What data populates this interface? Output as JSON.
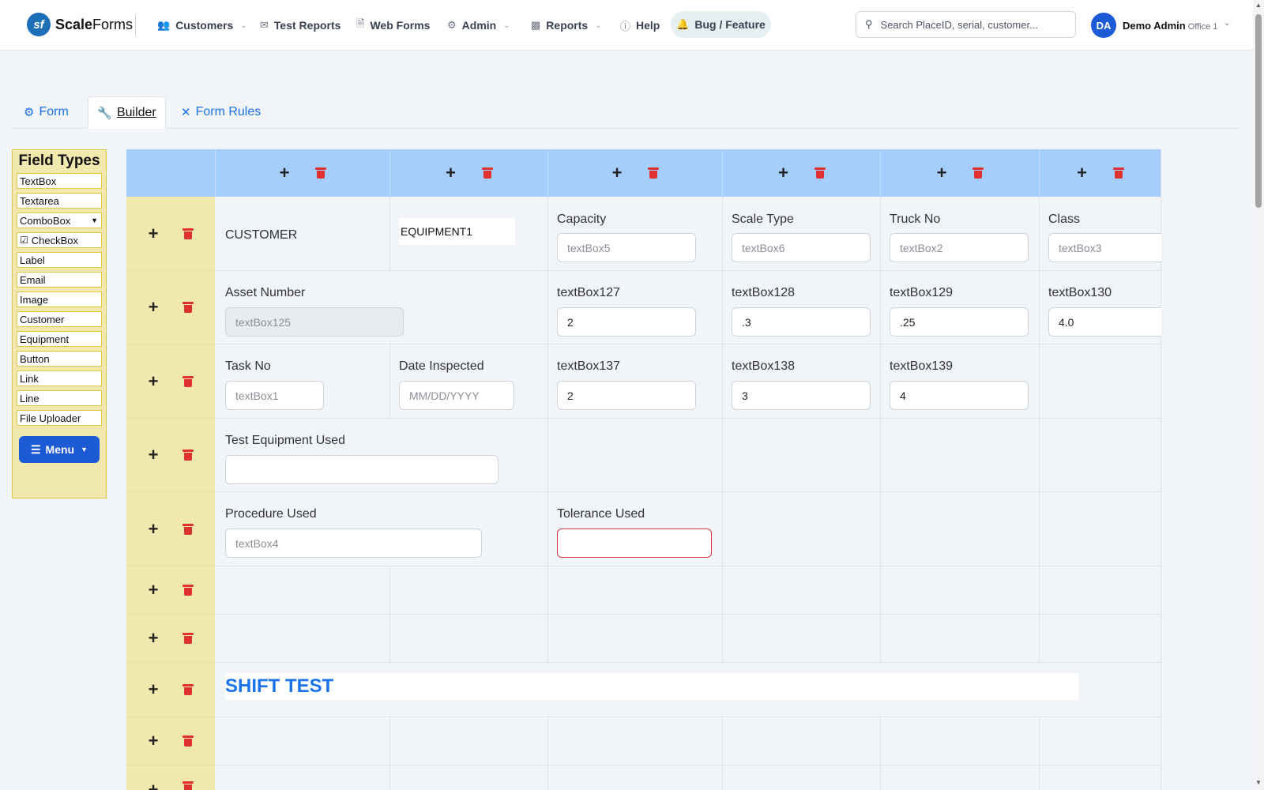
{
  "header": {
    "logo_mark": "sf",
    "logo_bold": "Scale",
    "logo_rest": "Forms",
    "nav": [
      {
        "label": "Customers",
        "icon": "users-icon"
      },
      {
        "label": "Test Reports",
        "icon": "mail-icon"
      },
      {
        "label": "Web Forms",
        "icon": "document-icon"
      },
      {
        "label": "Admin",
        "icon": "gear-icon"
      },
      {
        "label": "Reports",
        "icon": "bar-chart-icon"
      },
      {
        "label": "Help",
        "icon": "help-circle-icon"
      }
    ],
    "bug_label": "Bug / Feature",
    "search_placeholder": "Search PlaceID, serial, customer...",
    "avatar": "DA",
    "user_name": "Demo Admin",
    "office": "Office 1"
  },
  "tabs": [
    {
      "label": "Form",
      "icon": "gears-icon"
    },
    {
      "label": "Builder",
      "icon": "wrench-icon"
    },
    {
      "label": "Form Rules",
      "icon": "tools-icon"
    }
  ],
  "field_types": {
    "title": "Field Types",
    "items": [
      "TextBox",
      "Textarea",
      "ComboBox",
      "CheckBox",
      "Label",
      "Email",
      "Image",
      "Customer",
      "Equipment",
      "Button",
      "Link",
      "Line",
      "File Uploader"
    ],
    "menu_label": "Menu"
  },
  "grid": {
    "row1": {
      "customer": "CUSTOMER",
      "equipment": "EQUIPMENT1",
      "capacity_label": "Capacity",
      "capacity_ph": "textBox5",
      "scale_label": "Scale Type",
      "scale_ph": "textBox6",
      "truck_label": "Truck No",
      "truck_ph": "textBox2",
      "class_label": "Class",
      "class_ph": "textBox3"
    },
    "row2": {
      "asset_label": "Asset Number",
      "asset_ph": "textBox125",
      "tb127_label": "textBox127",
      "tb127_val": "2",
      "tb128_label": "textBox128",
      "tb128_val": ".3",
      "tb129_label": "textBox129",
      "tb129_val": ".25",
      "tb130_label": "textBox130",
      "tb130_val": "4.0"
    },
    "row3": {
      "task_label": "Task No",
      "task_ph": "textBox1",
      "date_label": "Date Inspected",
      "date_ph": "MM/DD/YYYY",
      "tb137_label": "textBox137",
      "tb137_val": "2",
      "tb138_label": "textBox138",
      "tb138_val": "3",
      "tb139_label": "textBox139",
      "tb139_val": "4"
    },
    "row4": {
      "equip_used_label": "Test Equipment Used",
      "equip_used_val": ""
    },
    "row5": {
      "proc_label": "Procedure Used",
      "proc_ph": "textBox4",
      "tol_label": "Tolerance Used",
      "tol_val": ""
    },
    "banner": "SHIFT TEST"
  }
}
